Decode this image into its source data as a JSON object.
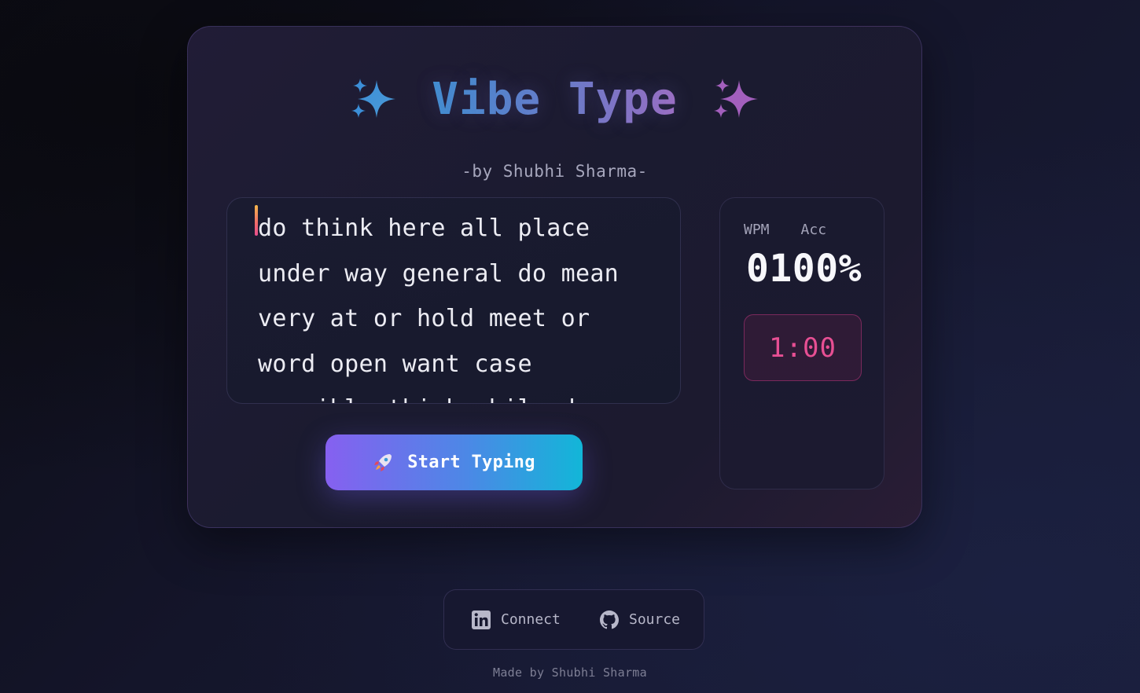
{
  "header": {
    "title": "Vibe Type",
    "subtitle": "-by Shubhi Sharma-"
  },
  "typing_area": {
    "lines": [
      "do think here all place",
      "under way general do mean",
      "very at or hold meet or",
      "word open want case",
      "possible think while day"
    ]
  },
  "start_button": {
    "label": "Start Typing",
    "icon": "rocket-icon"
  },
  "stats": {
    "wpm_label": "WPM",
    "acc_label": "Acc",
    "wpm_value": "0",
    "acc_value": "100%",
    "timer": "1:00"
  },
  "footer": {
    "linkedin_label": "Connect",
    "github_label": "Source",
    "linkedin_icon": "linkedin-icon",
    "github_icon": "github-icon",
    "made_by": "Made by Shubhi Sharma"
  },
  "colors": {
    "accent_blue": "#3f8fd0",
    "accent_purple": "#9e6fc2",
    "timer_pink": "#e74f93",
    "button_start": "#8660f0",
    "button_end": "#12b6d8"
  }
}
